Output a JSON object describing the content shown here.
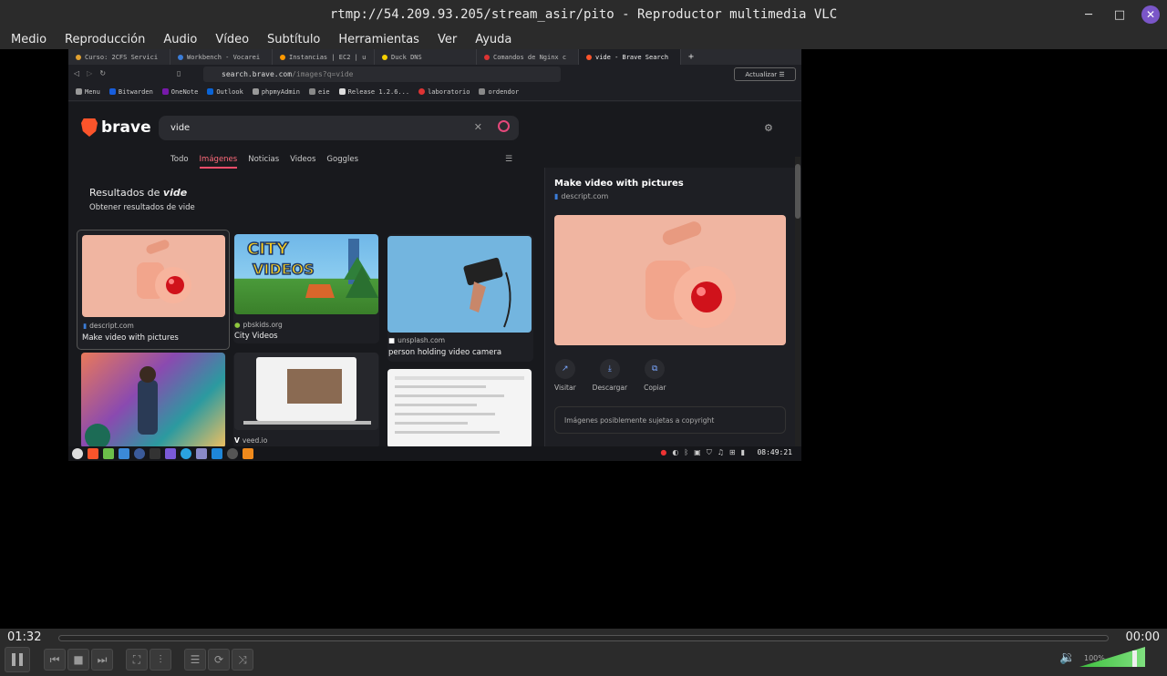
{
  "window": {
    "title": "rtmp://54.209.93.205/stream_asir/pito - Reproductor multimedia VLC",
    "minimize": "─",
    "maximize": "□",
    "close": "✕"
  },
  "menu": [
    "Medio",
    "Reproducción",
    "Audio",
    "Vídeo",
    "Subtítulo",
    "Herramientas",
    "Ver",
    "Ayuda"
  ],
  "browser": {
    "tabs": [
      {
        "label": "Curso: 2CFS Servici",
        "color": "#e0a030"
      },
      {
        "label": "Workbench - Vocarei",
        "color": "#3b7dd8"
      },
      {
        "label": "Instancias | EC2 | u",
        "color": "#ff9900"
      },
      {
        "label": "Duck DNS",
        "color": "#f5d000"
      },
      {
        "label": "Comandos de Nginx c",
        "color": "#d33"
      },
      {
        "label": "vide - Brave Search",
        "color": "#fb542b",
        "active": true
      }
    ],
    "url": {
      "host": "search.brave.com",
      "path": "/images?q=vide"
    },
    "update_button": "Actualizar ☰",
    "bookmarks": [
      {
        "label": "Menu",
        "color": "#999"
      },
      {
        "label": "Bitwarden",
        "color": "#175ddc"
      },
      {
        "label": "OneNote",
        "color": "#7719aa"
      },
      {
        "label": "Outlook",
        "color": "#0a64d6"
      },
      {
        "label": "phpmyAdmin",
        "color": "#999"
      },
      {
        "label": "eie",
        "color": "#888"
      },
      {
        "label": "Release 1.2.6...",
        "color": "#ddd"
      },
      {
        "label": "laboratorio",
        "color": "#d33"
      },
      {
        "label": "ordendor",
        "color": "#888"
      }
    ]
  },
  "brave": {
    "logo": "brave",
    "query": "vide",
    "nav": [
      "Todo",
      "Imágenes",
      "Noticias",
      "Videos",
      "Goggles"
    ],
    "nav_active": "Imágenes",
    "results_prefix": "Resultados de",
    "results_query": "vide",
    "results_sub": "Obtener resultados de vide",
    "cards": [
      {
        "source": "descript.com",
        "caption": "Make video with pictures"
      },
      {
        "source": "pbskids.org",
        "caption": "City Videos"
      },
      {
        "source": "unsplash.com",
        "caption": "person holding video camera"
      },
      {
        "source": "veed.io",
        "caption": ""
      }
    ],
    "city_title_1": "CITY",
    "city_title_2": "VIDEOS",
    "panel": {
      "title": "Make video with pictures",
      "source": "descript.com",
      "actions": [
        "Visitar",
        "Descargar",
        "Copiar"
      ],
      "copyright": "Imágenes posiblemente sujetas a copyright"
    }
  },
  "taskbar": {
    "clock": "08:49:21"
  },
  "player": {
    "elapsed": "01:32",
    "remaining": "00:00",
    "volume": "100%",
    "volume_level": 1.0
  }
}
